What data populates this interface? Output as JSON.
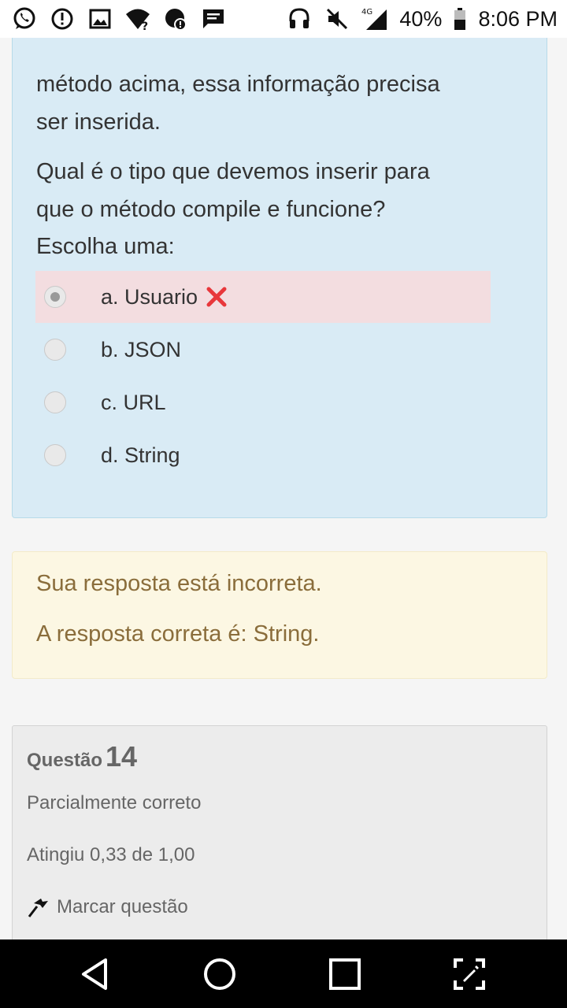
{
  "status_bar": {
    "left_icons": [
      "whatsapp-icon",
      "alert-icon",
      "gallery-icon",
      "wifi-question-icon",
      "data-saver-icon",
      "message-icon"
    ],
    "right_icons": [
      "headset-icon",
      "mute-icon",
      "signal-4g-icon",
      "battery-icon"
    ],
    "network": "4G",
    "battery": "40%",
    "time": "8:06 PM"
  },
  "question": {
    "text_lines": [
      "método acima, essa informação precisa",
      "ser inserida.",
      "Qual é o tipo que devemos inserir para",
      "que o método compile e funcione?"
    ],
    "choose_label": "Escolha uma:",
    "options": [
      {
        "label": "a. Usuario",
        "selected": true,
        "incorrect": true
      },
      {
        "label": "b. JSON",
        "selected": false
      },
      {
        "label": "c. URL",
        "selected": false
      },
      {
        "label": "d. String",
        "selected": false
      }
    ],
    "colors": {
      "panel": "#d9ebf5",
      "wrong_row": "#f3dde0",
      "x_mark": "#e8373b"
    }
  },
  "feedback": {
    "line1": "Sua resposta está incorreta.",
    "line2": "A resposta correta é: String."
  },
  "question_info": {
    "label": "Questão",
    "number": "14",
    "status": "Parcialmente correto",
    "score": "Atingiu 0,33 de 1,00",
    "flag_label": "Marcar questão"
  },
  "nav_bar": {
    "buttons": [
      "back-icon",
      "home-icon",
      "recents-icon",
      "expand-icon"
    ]
  }
}
